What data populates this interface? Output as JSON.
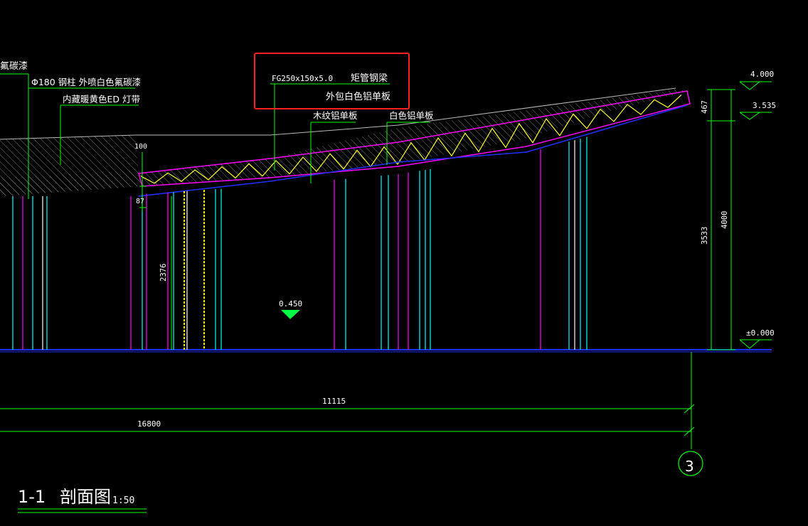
{
  "colors": {
    "background": "#000000",
    "text": "#ffffff",
    "dim": "#00ff00",
    "beam": "#ff00ff",
    "truss": "#ffff00",
    "soffit": "#2222ff",
    "column_cyan": "#00ffff",
    "column_magenta": "#ff00ff",
    "hatch": "#aaaaaa",
    "highlight": "#ff2020"
  },
  "labels": {
    "top_left_cut": "氟碳漆",
    "column_note": "Φ180  钢柱 外喷白色氟碳漆",
    "light_note": "内藏暖黄色ED 灯带",
    "beam_spec": "FG250x150x5.0",
    "beam_name": "矩管钢梁",
    "beam_cladding": "外包白色铝单板",
    "wood_panel": "木纹铝单板",
    "white_panel": "白色铝单板"
  },
  "elevations": {
    "top": "4.000",
    "mid": "3.535",
    "floor_ref": "0.450",
    "ground": "±0.000"
  },
  "dimensions": {
    "d100": "100",
    "d87": "87",
    "d2376": "2376",
    "d467": "467",
    "d3533": "3533",
    "d4000": "4000",
    "d11115": "11115",
    "d16800": "16800"
  },
  "grid_axis": "3",
  "section_title": {
    "id": "1-1",
    "name": "剖面图",
    "scale": "1:50"
  }
}
